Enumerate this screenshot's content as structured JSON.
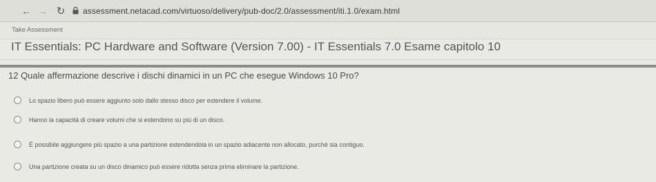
{
  "browser": {
    "url": "assessment.netacad.com/virtuoso/delivery/pub-doc/2.0/assessment/iti.1.0/exam.html",
    "back_icon": "←",
    "forward_icon": "→",
    "reload_icon": "↻"
  },
  "app": {
    "title": "Take Assessment"
  },
  "exam": {
    "title": "IT Essentials: PC Hardware and Software (Version 7.00) - IT Essentials 7.0 Esame capitolo 10"
  },
  "question": {
    "text": "12  Quale affermazione descrive i dischi dinamici in un PC che esegue Windows 10 Pro?",
    "options": [
      {
        "label": "Lo spazio libero può essere aggiunto solo dallo stesso disco per estendere il volume."
      },
      {
        "label": "Hanno la capacità di creare volumi che si estendono su più di un disco."
      },
      {
        "label": "È possibile aggiungere più spazio a una partizione estendendola in un spazio adiacente non allocato, purché sia contiguo."
      },
      {
        "label": "Una partizione creata su un disco dinamico può essere ridotta senza prima eliminare la partizione."
      }
    ]
  }
}
